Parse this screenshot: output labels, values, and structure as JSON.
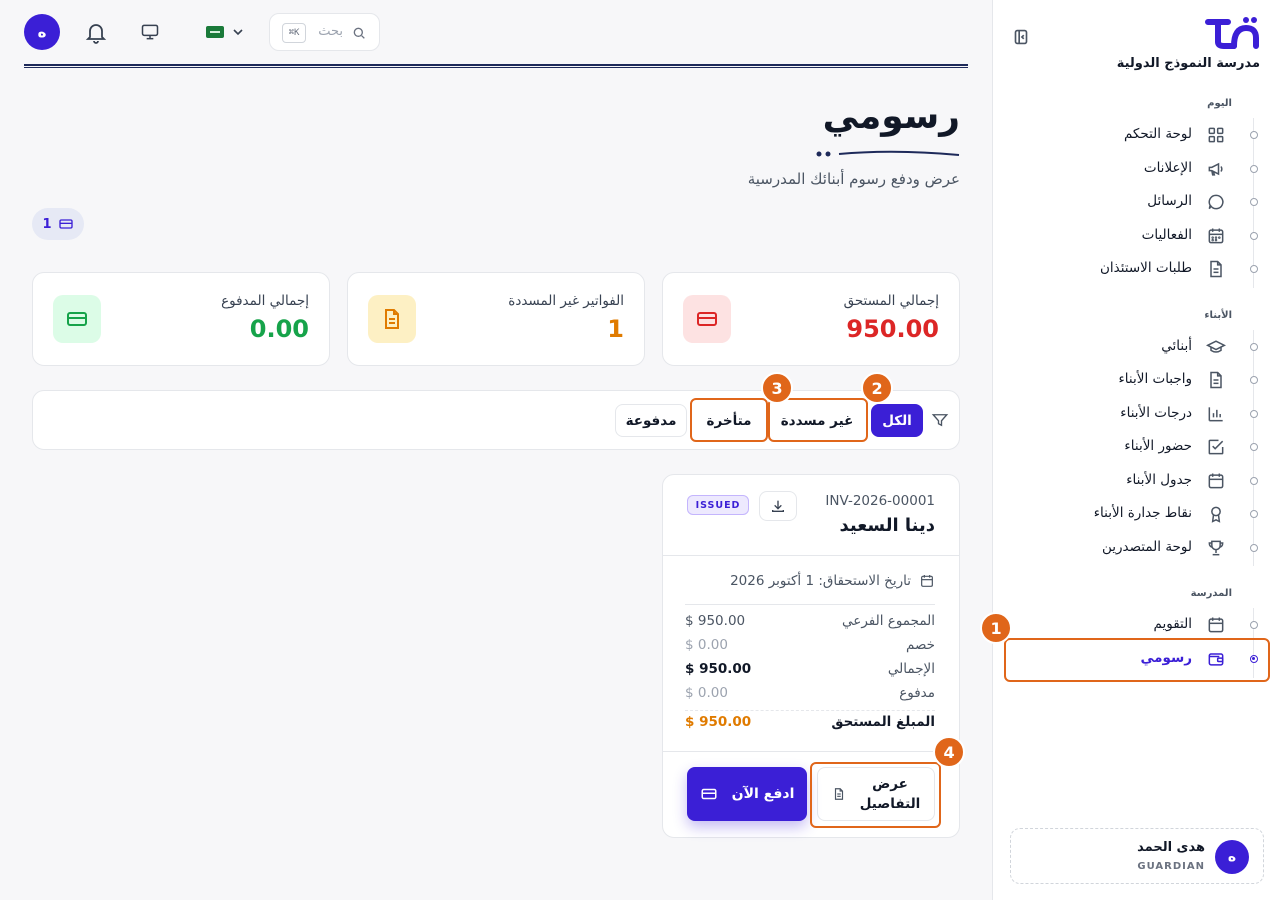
{
  "topbar": {
    "avatar_initial": "ه",
    "search_placeholder": "بحث",
    "search_shortcut": "K⌘"
  },
  "sidebar": {
    "school_name": "مدرسة النموذج الدولية",
    "sections": [
      {
        "label": "اليوم",
        "items": [
          {
            "label": "لوحة التحكم",
            "icon": "dashboard-icon"
          },
          {
            "label": "الإعلانات",
            "icon": "megaphone-icon"
          },
          {
            "label": "الرسائل",
            "icon": "chat-icon"
          },
          {
            "label": "الفعاليات",
            "icon": "calendar-grid-icon"
          },
          {
            "label": "طلبات الاستئذان",
            "icon": "document-icon"
          }
        ]
      },
      {
        "label": "الأبناء",
        "items": [
          {
            "label": "أبنائي",
            "icon": "graduation-cap-icon"
          },
          {
            "label": "واجبات الأبناء",
            "icon": "document-icon"
          },
          {
            "label": "درجات الأبناء",
            "icon": "bar-chart-icon"
          },
          {
            "label": "حضور الأبناء",
            "icon": "check-square-icon"
          },
          {
            "label": "جدول الأبناء",
            "icon": "calendar-icon"
          },
          {
            "label": "نقاط جدارة الأبناء",
            "icon": "award-icon"
          },
          {
            "label": "لوحة المتصدرين",
            "icon": "trophy-icon"
          }
        ]
      },
      {
        "label": "المدرسة",
        "items": [
          {
            "label": "التقويم",
            "icon": "calendar-icon"
          },
          {
            "label": "رسومي",
            "icon": "wallet-icon",
            "active": true
          }
        ]
      }
    ],
    "user": {
      "initial": "ه",
      "name": "هدى الحمد",
      "role": "GUARDIAN"
    }
  },
  "page": {
    "title": "رسومي",
    "subtitle": "عرض ودفع رسوم أبنائك المدرسية",
    "count": "1"
  },
  "stats": [
    {
      "label": "إجمالي المستحق",
      "value": "950.00",
      "color": "#dc2626",
      "bg": "#fde2e2",
      "icon": "credit-card-icon"
    },
    {
      "label": "الفواتير غير المسددة",
      "value": "1",
      "color": "#e07b00",
      "bg": "#fdf0c4",
      "icon": "document-icon"
    },
    {
      "label": "إجمالي المدفوع",
      "value": "0.00",
      "color": "#16a34a",
      "bg": "#dcfce7",
      "icon": "credit-card-icon"
    }
  ],
  "filters": [
    {
      "label": "الكل",
      "active": true
    },
    {
      "label": "غير مسددة"
    },
    {
      "label": "متأخرة"
    },
    {
      "label": "مدفوعة"
    }
  ],
  "annotations": [
    "1",
    "2",
    "3",
    "4"
  ],
  "invoice": {
    "number": "INV-2026-00001",
    "student": "دينا السعيد",
    "status": "ISSUED",
    "due_date": "تاريخ الاستحقاق: 1 أكتوبر 2026",
    "rows": [
      {
        "label": "المجموع الفرعي",
        "value": "$ 950.00"
      },
      {
        "label": "خصم",
        "value": "$ 0.00"
      },
      {
        "label": "الإجمالي",
        "value": "$ 950.00"
      },
      {
        "label": "مدفوع",
        "value": "$ 0.00"
      },
      {
        "label": "المبلغ المستحق",
        "value": "$ 950.00"
      }
    ],
    "details_label_1": "عرض",
    "details_label_2": "التفاصيل",
    "pay_label": "ادفع الآن"
  },
  "colors": {
    "primary": "#3b1fd6",
    "annotation": "#e0661a",
    "navy": "#1e2a5a"
  }
}
